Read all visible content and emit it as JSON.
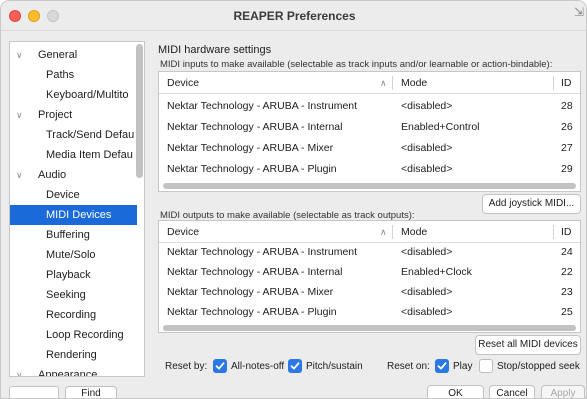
{
  "window": {
    "title": "REAPER Preferences"
  },
  "sidebar": {
    "items": [
      {
        "label": "General",
        "expandable": true
      },
      {
        "label": "Paths",
        "expandable": false
      },
      {
        "label": "Keyboard/Multito",
        "expandable": false
      },
      {
        "label": "Project",
        "expandable": true
      },
      {
        "label": "Track/Send Defau",
        "expandable": false
      },
      {
        "label": "Media Item Defau",
        "expandable": false
      },
      {
        "label": "Audio",
        "expandable": true
      },
      {
        "label": "Device",
        "expandable": false
      },
      {
        "label": "MIDI Devices",
        "expandable": false,
        "selected": true
      },
      {
        "label": "Buffering",
        "expandable": false
      },
      {
        "label": "Mute/Solo",
        "expandable": false
      },
      {
        "label": "Playback",
        "expandable": false
      },
      {
        "label": "Seeking",
        "expandable": false
      },
      {
        "label": "Recording",
        "expandable": false
      },
      {
        "label": "Loop Recording",
        "expandable": false
      },
      {
        "label": "Rendering",
        "expandable": false
      },
      {
        "label": "Appearance",
        "expandable": true
      }
    ],
    "find_button": "Find",
    "search_value": ""
  },
  "main": {
    "section_title": "MIDI hardware settings",
    "inputs_caption": "MIDI inputs to make available (selectable as track inputs and/or learnable or action-bindable):",
    "outputs_caption": "MIDI outputs to make available (selectable as track outputs):",
    "columns": {
      "device": "Device",
      "mode": "Mode",
      "id": "ID"
    },
    "inputs": [
      {
        "device": "Nektar Technology - ARUBA - Instrument",
        "mode": "<disabled>",
        "id": "28"
      },
      {
        "device": "Nektar Technology - ARUBA - Internal",
        "mode": "Enabled+Control",
        "id": "26"
      },
      {
        "device": "Nektar Technology - ARUBA - Mixer",
        "mode": "<disabled>",
        "id": "27"
      },
      {
        "device": "Nektar Technology - ARUBA - Plugin",
        "mode": "<disabled>",
        "id": "29"
      }
    ],
    "outputs": [
      {
        "device": "Nektar Technology - ARUBA - Instrument",
        "mode": "<disabled>",
        "id": "24"
      },
      {
        "device": "Nektar Technology - ARUBA - Internal",
        "mode": "Enabled+Clock",
        "id": "22"
      },
      {
        "device": "Nektar Technology - ARUBA - Mixer",
        "mode": "<disabled>",
        "id": "23"
      },
      {
        "device": "Nektar Technology - ARUBA - Plugin",
        "mode": "<disabled>",
        "id": "25"
      }
    ],
    "add_joystick_button": "Add joystick MIDI...",
    "reset_all_button": "Reset all MIDI devices",
    "reset_by_label": "Reset by:",
    "reset_by_options": [
      {
        "label": "All-notes-off",
        "checked": true
      },
      {
        "label": "Pitch/sustain",
        "checked": true
      }
    ],
    "reset_on_label": "Reset on:",
    "reset_on_options": [
      {
        "label": "Play",
        "checked": true
      },
      {
        "label": "Stop/stopped seek",
        "checked": false
      }
    ]
  },
  "footer": {
    "ok": "OK",
    "cancel": "Cancel",
    "apply": "Apply"
  },
  "colors": {
    "selection": "#1b6ad9",
    "checkbox": "#2b77e6",
    "close": "#ff5f57",
    "minimize": "#febc2e"
  }
}
